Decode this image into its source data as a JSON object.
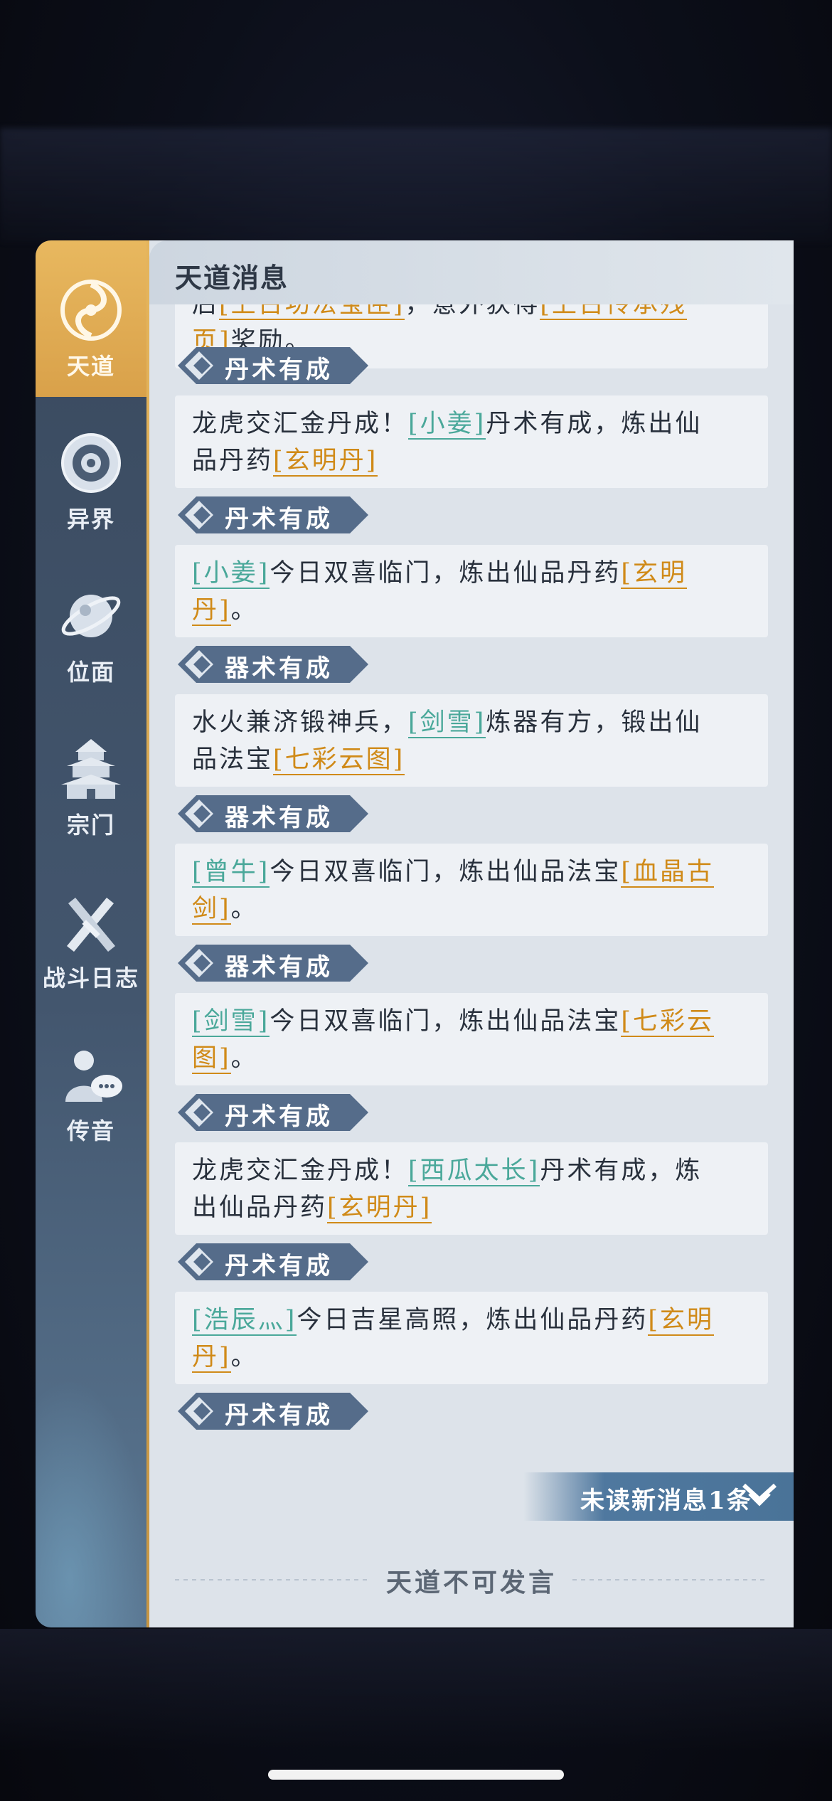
{
  "panel": {
    "title": "天道消息"
  },
  "sidebar": {
    "items": [
      {
        "label": "天道",
        "icon": "tiandao-emblem-icon",
        "active": true
      },
      {
        "label": "异界",
        "icon": "otherworld-eye-icon"
      },
      {
        "label": "位面",
        "icon": "planet-icon"
      },
      {
        "label": "宗门",
        "icon": "pagoda-icon"
      },
      {
        "label": "战斗日志",
        "icon": "crossed-swords-icon"
      },
      {
        "label": "传音",
        "icon": "messenger-icon"
      }
    ]
  },
  "messages": [
    {
      "tag": "",
      "parts": [
        {
          "t": "后",
          "k": "text"
        },
        {
          "t": "[上古功法宝匣]",
          "k": "item"
        },
        {
          "t": "，意外获得",
          "k": "text"
        },
        {
          "t": "[上古传承残",
          "k": "item"
        }
      ],
      "parts2": [
        {
          "t": "页]",
          "k": "item"
        },
        {
          "t": "奖励。",
          "k": "text"
        }
      ]
    },
    {
      "tag": "丹术有成",
      "line1": [
        {
          "t": "龙虎交汇金丹成！",
          "k": "text"
        },
        {
          "t": "[小姜]",
          "k": "name"
        },
        {
          "t": "丹术有成，炼出仙",
          "k": "text"
        }
      ],
      "line2": [
        {
          "t": "品丹药",
          "k": "text"
        },
        {
          "t": "[玄明丹]",
          "k": "item"
        }
      ]
    },
    {
      "tag": "丹术有成",
      "line1": [
        {
          "t": "[小姜]",
          "k": "name"
        },
        {
          "t": "今日双喜临门，炼出仙品丹药",
          "k": "text"
        },
        {
          "t": "[玄明",
          "k": "item"
        }
      ],
      "line2": [
        {
          "t": "丹]",
          "k": "item"
        },
        {
          "t": "。",
          "k": "text"
        }
      ]
    },
    {
      "tag": "器术有成",
      "line1": [
        {
          "t": "水火兼济锻神兵，",
          "k": "text"
        },
        {
          "t": "[剑雪]",
          "k": "name"
        },
        {
          "t": "炼器有方，锻出仙",
          "k": "text"
        }
      ],
      "line2": [
        {
          "t": "品法宝",
          "k": "text"
        },
        {
          "t": "[七彩云图]",
          "k": "item"
        }
      ]
    },
    {
      "tag": "器术有成",
      "line1": [
        {
          "t": "[曾牛]",
          "k": "name"
        },
        {
          "t": "今日双喜临门，炼出仙品法宝",
          "k": "text"
        },
        {
          "t": "[血晶古",
          "k": "item"
        }
      ],
      "line2": [
        {
          "t": "剑]",
          "k": "item"
        },
        {
          "t": "。",
          "k": "text"
        }
      ]
    },
    {
      "tag": "器术有成",
      "line1": [
        {
          "t": "[剑雪]",
          "k": "name"
        },
        {
          "t": "今日双喜临门，炼出仙品法宝",
          "k": "text"
        },
        {
          "t": "[七彩云",
          "k": "item"
        }
      ],
      "line2": [
        {
          "t": "图]",
          "k": "item"
        },
        {
          "t": "。",
          "k": "text"
        }
      ]
    },
    {
      "tag": "丹术有成",
      "line1": [
        {
          "t": "龙虎交汇金丹成！",
          "k": "text"
        },
        {
          "t": "[西瓜太长]",
          "k": "name"
        },
        {
          "t": "丹术有成，炼",
          "k": "text"
        }
      ],
      "line2": [
        {
          "t": "出仙品丹药",
          "k": "text"
        },
        {
          "t": "[玄明丹]",
          "k": "item"
        }
      ]
    },
    {
      "tag": "丹术有成",
      "line1": [
        {
          "t": "[浩辰灬]",
          "k": "name"
        },
        {
          "t": "今日吉星高照，炼出仙品丹药",
          "k": "text"
        },
        {
          "t": "[玄明",
          "k": "item"
        }
      ],
      "line2": [
        {
          "t": "丹]",
          "k": "item"
        },
        {
          "t": "。",
          "k": "text"
        }
      ]
    },
    {
      "tag": "丹术有成"
    }
  ],
  "unread": {
    "label": "未读新消息1条",
    "icon": "double-chevron-down-icon"
  },
  "footer": {
    "text": "天道不可发言"
  },
  "colors": {
    "accent_gold": "#e0ad55",
    "name_teal": "#4aa89a",
    "item_orange": "#d08a18",
    "tag_blue": "#556c8a"
  }
}
